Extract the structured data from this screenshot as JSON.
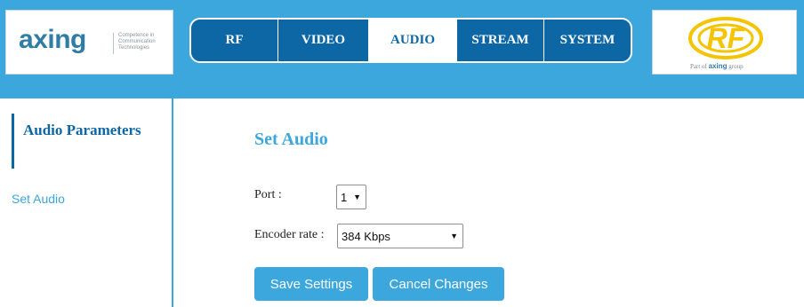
{
  "header": {
    "logo_text": "axing",
    "logo_tagline": "Competence in Communication Technologies",
    "partner_logo": {
      "mark": "RF",
      "part_of_prefix": "Part of",
      "part_of_brand": "axing",
      "part_of_suffix": "group"
    }
  },
  "nav": {
    "tabs": [
      {
        "label": "RF",
        "active": false
      },
      {
        "label": "VIDEO",
        "active": false
      },
      {
        "label": "AUDIO",
        "active": true
      },
      {
        "label": "STREAM",
        "active": false
      },
      {
        "label": "SYSTEM",
        "active": false
      }
    ]
  },
  "sidebar": {
    "heading": "Audio Parameters",
    "items": [
      {
        "label": "Set Audio"
      }
    ]
  },
  "main": {
    "title": "Set Audio",
    "port_label": "Port :",
    "port_value": "1",
    "encoder_label": "Encoder rate :",
    "encoder_value": "384 Kbps",
    "save_label": "Save Settings",
    "cancel_label": "Cancel Changes"
  },
  "colors": {
    "header_bg": "#3ba7dd",
    "nav_bg": "#0e67a5",
    "accent": "#3ba7dd",
    "logo_blue": "#2f7da7",
    "rf_yellow": "#f5c400"
  }
}
